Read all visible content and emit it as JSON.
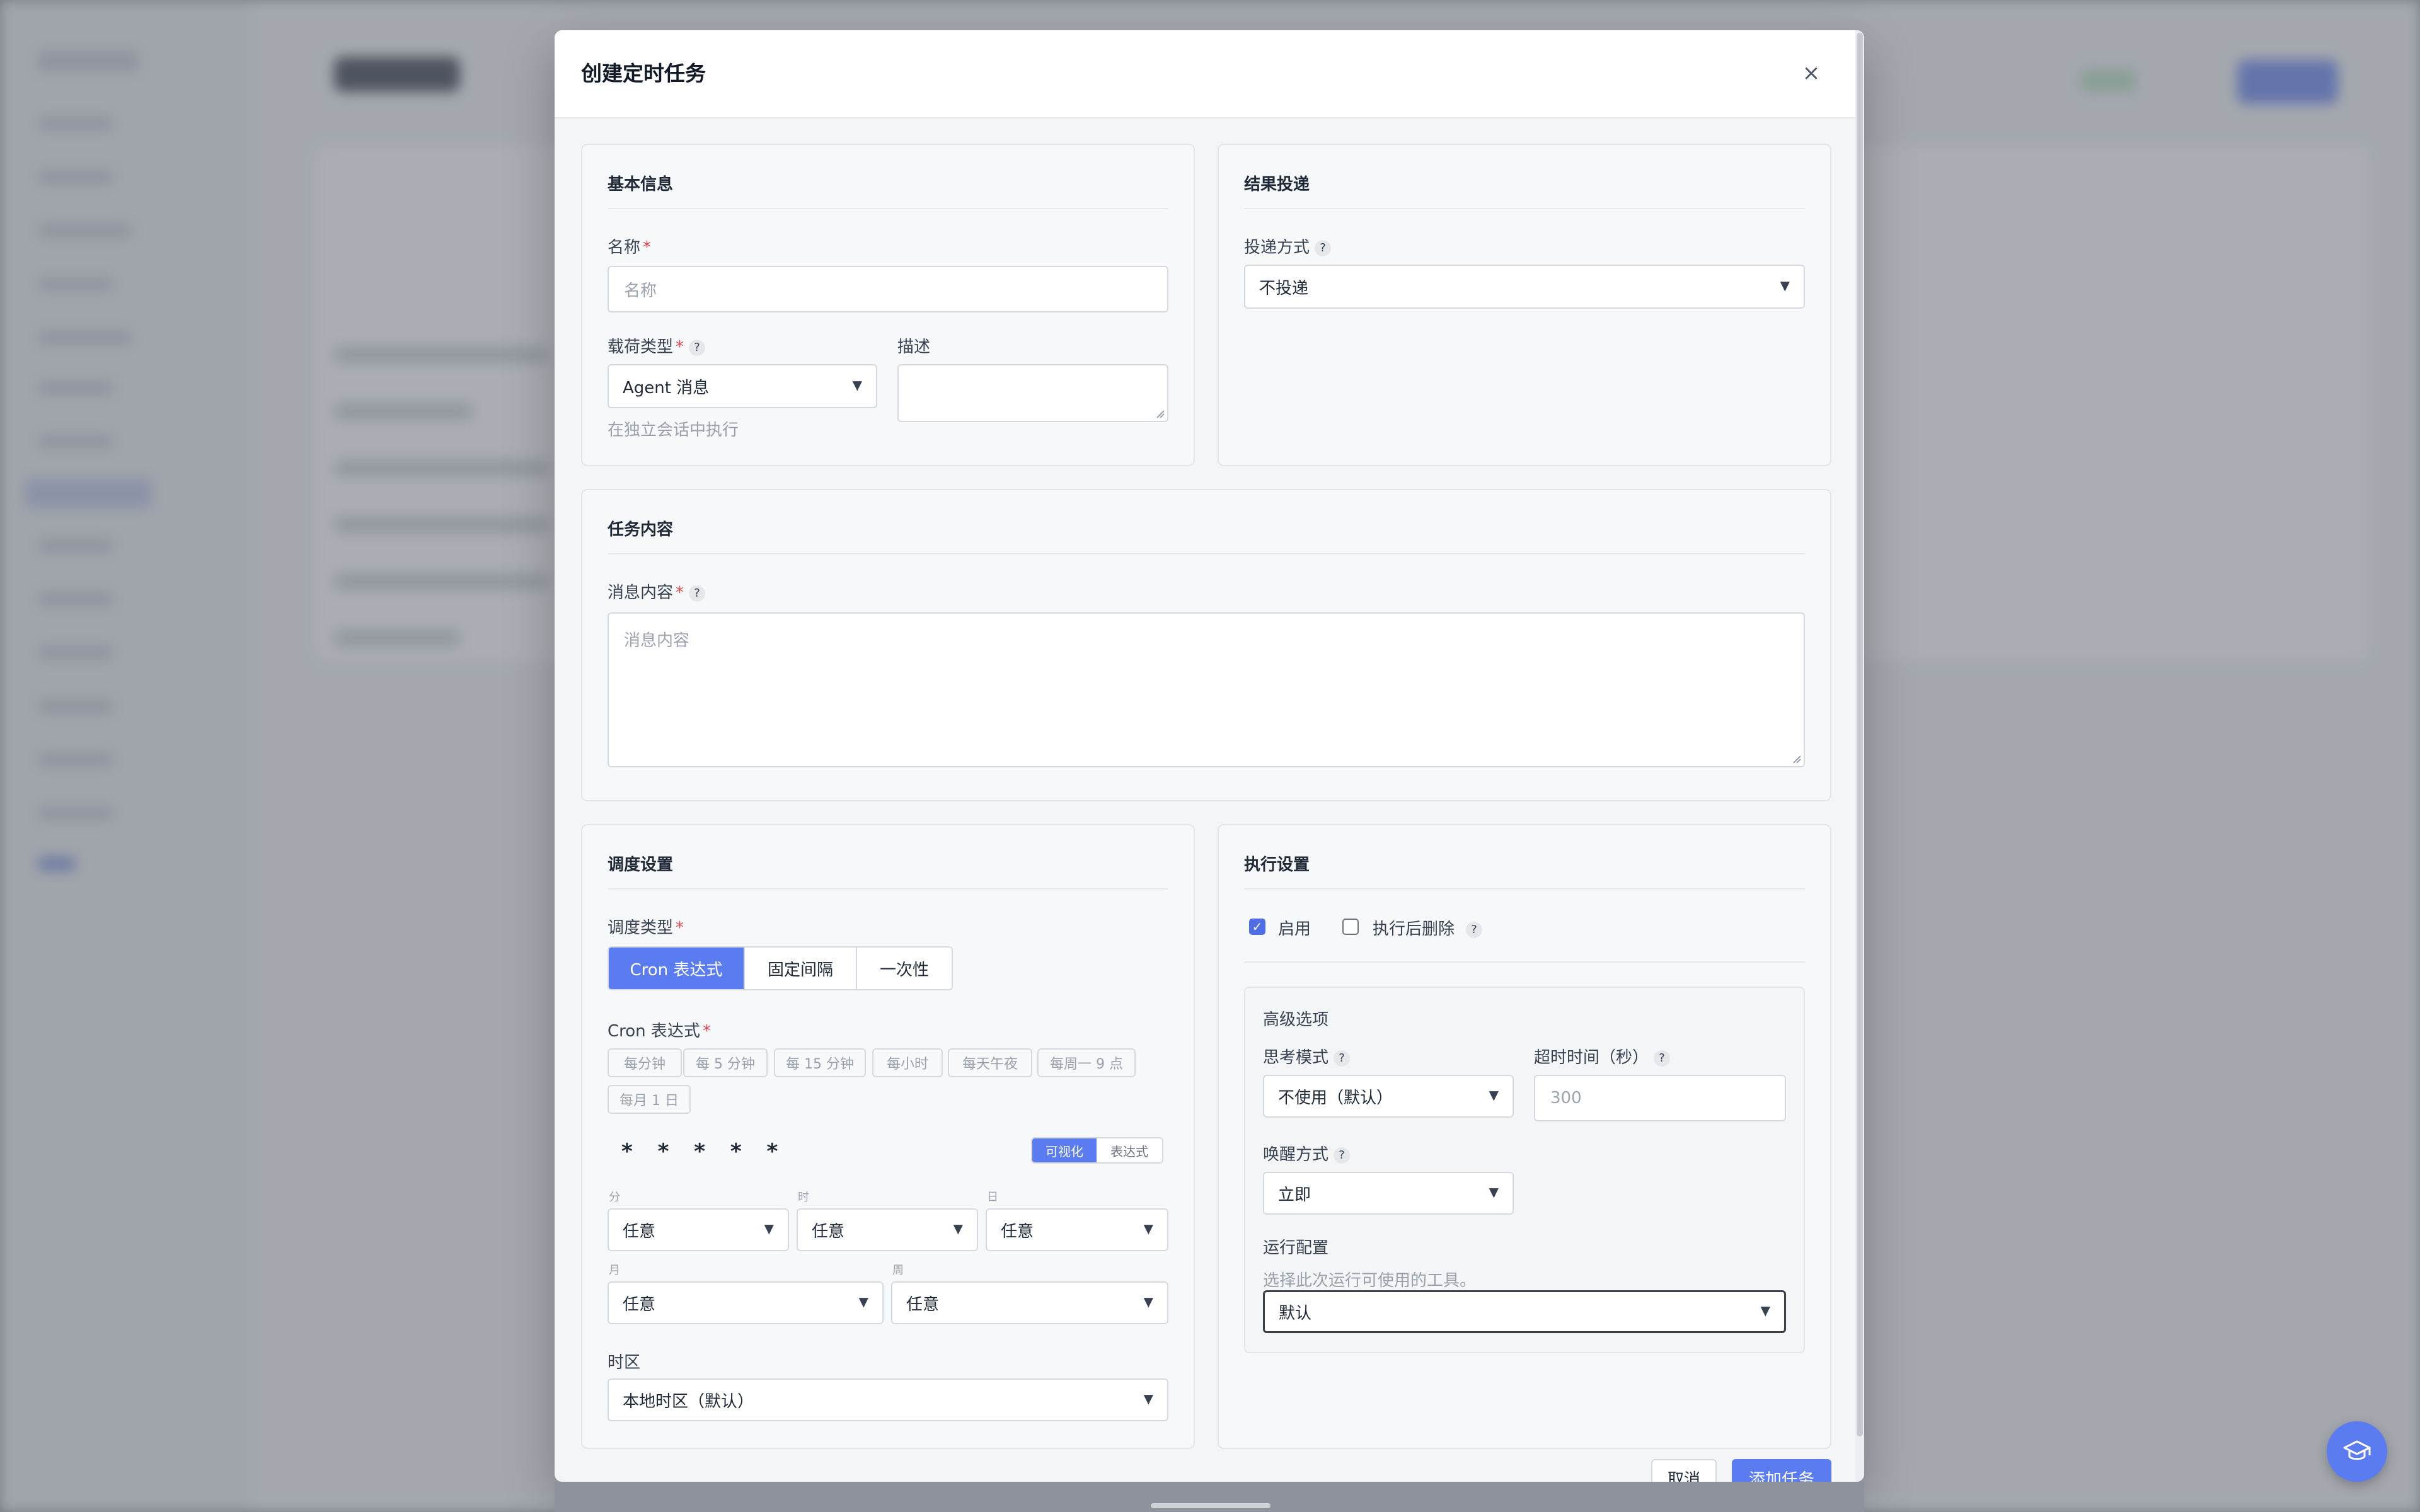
{
  "modal": {
    "title": "创建定时任务",
    "close": "×"
  },
  "basic_info": {
    "title": "基本信息",
    "name_label": "名称",
    "name_placeholder": "名称",
    "payload_label": "载荷类型",
    "payload_value": "Agent 消息",
    "payload_hint": "在独立会话中执行",
    "desc_label": "描述",
    "required_mark": "*",
    "help": "?"
  },
  "delivery": {
    "title": "结果投递",
    "method_label": "投递方式",
    "method_value": "不投递"
  },
  "task_content": {
    "title": "任务内容",
    "message_label": "消息内容",
    "message_placeholder": "消息内容"
  },
  "schedule": {
    "title": "调度设置",
    "type_label": "调度类型",
    "types": [
      "Cron 表达式",
      "固定间隔",
      "一次性"
    ],
    "active_type": "Cron 表达式",
    "cron_label": "Cron 表达式",
    "presets": [
      "每分钟",
      "每 5 分钟",
      "每 15 分钟",
      "每小时",
      "每天午夜",
      "每周一 9 点",
      "每月 1 日"
    ],
    "expression": "* * * * *",
    "view_modes": [
      "可视化",
      "表达式"
    ],
    "active_view": "可视化",
    "fields": {
      "minute": {
        "label": "分",
        "value": "任意"
      },
      "hour": {
        "label": "时",
        "value": "任意"
      },
      "day": {
        "label": "日",
        "value": "任意"
      },
      "month": {
        "label": "月",
        "value": "任意"
      },
      "week": {
        "label": "周",
        "value": "任意"
      }
    },
    "timezone_label": "时区",
    "timezone_value": "本地时区（默认）"
  },
  "execution": {
    "title": "执行设置",
    "enable_label": "启用",
    "enable_checked": true,
    "delete_after_label": "执行后删除",
    "delete_after_checked": false,
    "advanced_title": "高级选项",
    "thinking_label": "思考模式",
    "thinking_value": "不使用（默认）",
    "timeout_label": "超时时间（秒）",
    "timeout_placeholder": "300",
    "wake_label": "唤醒方式",
    "wake_value": "立即",
    "run_config_label": "运行配置",
    "run_config_hint": "选择此次运行可使用的工具。",
    "run_config_value": "默认"
  },
  "footer": {
    "cancel": "取消",
    "submit": "添加任务"
  },
  "colors": {
    "primary": "#5b7cf0",
    "required": "#e5484d"
  }
}
